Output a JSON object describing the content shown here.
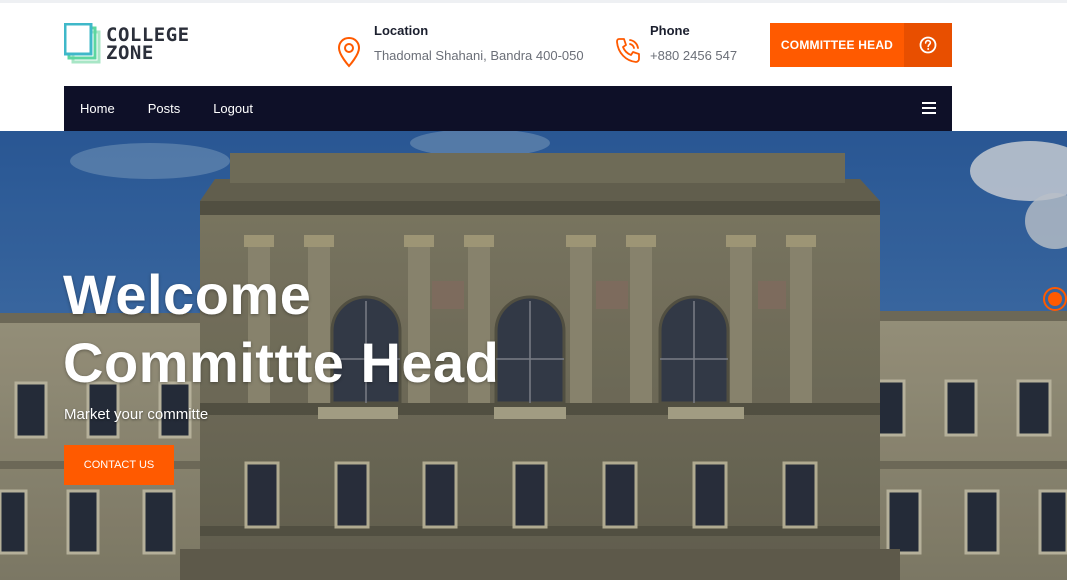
{
  "brand": {
    "line1": "COLLEGE",
    "line2": "ZONE"
  },
  "contact_info": {
    "location": {
      "label": "Location",
      "value": "Thadomal Shahani, Bandra 400-050",
      "icon": "map-pin-icon"
    },
    "phone": {
      "label": "Phone",
      "value": "+880 2456 547",
      "icon": "phone-icon"
    }
  },
  "header_cta": {
    "label": "COMMITTEE HEAD",
    "icon": "question-circle-icon"
  },
  "nav": {
    "items": [
      {
        "label": "Home"
      },
      {
        "label": "Posts"
      },
      {
        "label": "Logout"
      }
    ],
    "menu_icon": "hamburger-icon"
  },
  "hero": {
    "title_line1": "Welcome",
    "title_line2": "Committte Head",
    "subtitle": "Market your committe",
    "button_label": "CONTACT US"
  },
  "colors": {
    "accent": "#ff5a00",
    "accent_dark": "#e84f00",
    "nav_bg": "#0e1028",
    "logo_green": "#5cd6a0",
    "logo_teal": "#3fb8c9"
  }
}
